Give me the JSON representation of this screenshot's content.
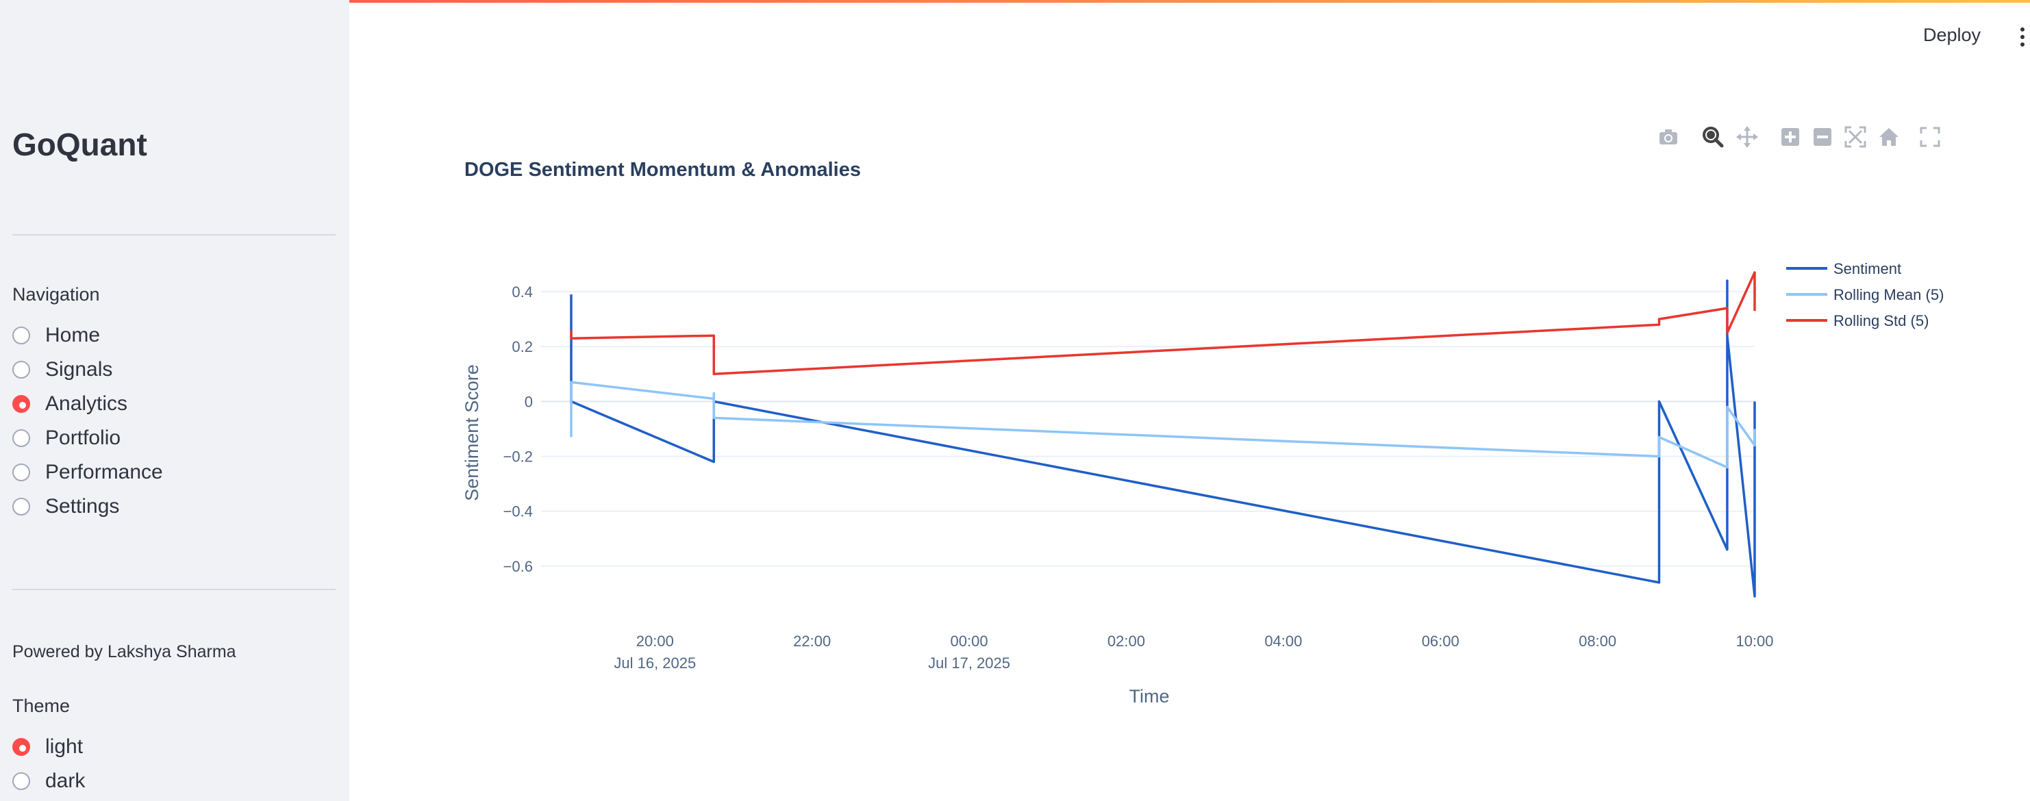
{
  "sidebar": {
    "brand": "GoQuant",
    "navigation_label": "Navigation",
    "nav_items": [
      {
        "label": "Home",
        "checked": false
      },
      {
        "label": "Signals",
        "checked": false
      },
      {
        "label": "Analytics",
        "checked": true
      },
      {
        "label": "Portfolio",
        "checked": false
      },
      {
        "label": "Performance",
        "checked": false
      },
      {
        "label": "Settings",
        "checked": false
      }
    ],
    "powered_by": "Powered by Lakshya Sharma",
    "theme_label": "Theme",
    "theme_items": [
      {
        "label": "light",
        "checked": true
      },
      {
        "label": "dark",
        "checked": false
      }
    ]
  },
  "header": {
    "deploy_label": "Deploy"
  },
  "modebar": {
    "icons": [
      "camera-icon",
      "zoom-icon",
      "pan-icon",
      "zoom-in-icon",
      "zoom-out-icon",
      "autoscale-icon",
      "home-icon",
      "fullscreen-icon"
    ]
  },
  "colors": {
    "accent": "#ff4b4b",
    "sentiment": "#1f5fc8",
    "rolling_mean": "#8ec5f7",
    "rolling_std": "#e8372f"
  },
  "chart_data": {
    "type": "line",
    "title": "DOGE Sentiment Momentum & Anomalies",
    "xlabel": "Time",
    "ylabel": "Sentiment Score",
    "x_tick_labels": [
      {
        "t": "2025-07-16T20:00",
        "lines": [
          "20:00",
          "Jul 16, 2025"
        ]
      },
      {
        "t": "2025-07-16T22:00",
        "lines": [
          "22:00"
        ]
      },
      {
        "t": "2025-07-17T00:00",
        "lines": [
          "00:00",
          "Jul 17, 2025"
        ]
      },
      {
        "t": "2025-07-17T02:00",
        "lines": [
          "02:00"
        ]
      },
      {
        "t": "2025-07-17T04:00",
        "lines": [
          "04:00"
        ]
      },
      {
        "t": "2025-07-17T06:00",
        "lines": [
          "06:00"
        ]
      },
      {
        "t": "2025-07-17T08:00",
        "lines": [
          "08:00"
        ]
      },
      {
        "t": "2025-07-17T10:00",
        "lines": [
          "10:00"
        ]
      }
    ],
    "y_ticks": [
      0.4,
      0.2,
      0,
      -0.2,
      -0.4,
      -0.6
    ],
    "y_tick_labels": [
      "0.4",
      "0.2",
      "0",
      "−0.2",
      "−0.4",
      "−0.6"
    ],
    "xlim": [
      "2025-07-16T18:33",
      "2025-07-17T10:00"
    ],
    "ylim": [
      -0.72,
      0.47
    ],
    "grid": true,
    "legend_position": "top-right",
    "series": [
      {
        "name": "Sentiment",
        "points": [
          [
            "2025-07-16T18:56",
            0.39
          ],
          [
            "2025-07-16T18:56",
            0.0
          ],
          [
            "2025-07-16T20:45",
            -0.22
          ],
          [
            "2025-07-16T20:45",
            0.0
          ],
          [
            "2025-07-17T08:47",
            -0.66
          ],
          [
            "2025-07-17T08:47",
            0.0
          ],
          [
            "2025-07-17T09:39",
            -0.54
          ],
          [
            "2025-07-17T09:39",
            0.44
          ],
          [
            "2025-07-17T09:39",
            0.24
          ],
          [
            "2025-07-17T10:00",
            -0.71
          ],
          [
            "2025-07-17T10:00",
            0.0
          ]
        ]
      },
      {
        "name": "Rolling Mean (5)",
        "points": [
          [
            "2025-07-16T18:56",
            -0.13
          ],
          [
            "2025-07-16T18:56",
            0.07
          ],
          [
            "2025-07-16T20:45",
            0.01
          ],
          [
            "2025-07-16T20:45",
            0.03
          ],
          [
            "2025-07-16T20:45",
            -0.06
          ],
          [
            "2025-07-17T08:47",
            -0.2
          ],
          [
            "2025-07-17T08:47",
            -0.13
          ],
          [
            "2025-07-17T09:39",
            -0.24
          ],
          [
            "2025-07-17T09:39",
            -0.02
          ],
          [
            "2025-07-17T10:00",
            -0.16
          ],
          [
            "2025-07-17T10:00",
            -0.1
          ]
        ]
      },
      {
        "name": "Rolling Std (5)",
        "points": [
          [
            "2025-07-16T18:56",
            0.26
          ],
          [
            "2025-07-16T18:56",
            0.23
          ],
          [
            "2025-07-16T20:45",
            0.24
          ],
          [
            "2025-07-16T20:45",
            0.1
          ],
          [
            "2025-07-17T08:47",
            0.28
          ],
          [
            "2025-07-17T08:47",
            0.3
          ],
          [
            "2025-07-17T09:39",
            0.34
          ],
          [
            "2025-07-17T09:39",
            0.25
          ],
          [
            "2025-07-17T10:00",
            0.47
          ],
          [
            "2025-07-17T10:00",
            0.33
          ]
        ]
      }
    ]
  }
}
